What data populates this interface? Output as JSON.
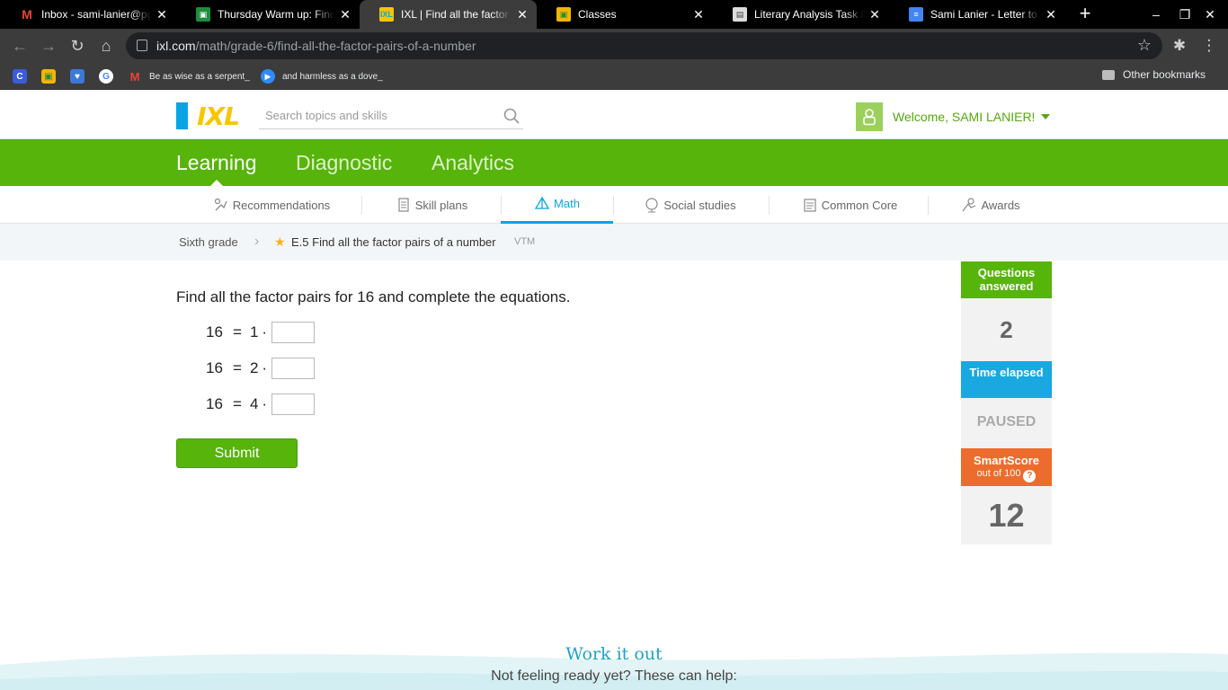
{
  "browser": {
    "tabs": [
      {
        "title": "Inbox - sami-lanier@pgcps.org",
        "icon": "gmail-icon",
        "active": false
      },
      {
        "title": "Thursday Warm up: Find the factor pairs",
        "icon": "classroom-icon",
        "active": false
      },
      {
        "title": "IXL | Find all the factor pairs",
        "icon": "ixl-icon",
        "active": true
      },
      {
        "title": "Classes",
        "icon": "classroom-icon",
        "active": false
      },
      {
        "title": "Literary Analysis Task Pi",
        "icon": "classroom-assignment-icon",
        "active": false
      },
      {
        "title": "Sami Lanier - Letter to Co",
        "icon": "docs-icon",
        "active": false
      }
    ],
    "url_host": "ixl.com",
    "url_path": "/math/grade-6/find-all-the-factor-pairs-of-a-number",
    "bookmarks": [
      {
        "label": "",
        "icon": "canvas-icon"
      },
      {
        "label": "",
        "icon": "classroom-icon"
      },
      {
        "label": "",
        "icon": "heart-icon"
      },
      {
        "label": "",
        "icon": "google-icon"
      },
      {
        "label": "Be as wise as a serpent_",
        "icon": "gmail-icon"
      },
      {
        "label": "and harmless as a dove_",
        "icon": "zoom-icon"
      }
    ],
    "other_bookmarks": "Other bookmarks"
  },
  "header": {
    "logo": "IXL",
    "search_placeholder": "Search topics and skills",
    "welcome": "Welcome, SAMI LANIER!"
  },
  "main_nav": [
    {
      "label": "Learning",
      "active": true
    },
    {
      "label": "Diagnostic",
      "active": false
    },
    {
      "label": "Analytics",
      "active": false
    }
  ],
  "sub_nav": [
    {
      "label": "Recommendations",
      "icon": "recommendations-icon"
    },
    {
      "label": "Skill plans",
      "icon": "skill-plans-icon"
    },
    {
      "label": "Math",
      "icon": "math-pyramid-icon",
      "active": true
    },
    {
      "label": "Social studies",
      "icon": "globe-icon"
    },
    {
      "label": "Common Core",
      "icon": "common-core-icon"
    },
    {
      "label": "Awards",
      "icon": "awards-icon"
    }
  ],
  "breadcrumb": {
    "grade": "Sixth grade",
    "skill": "E.5 Find all the factor pairs of a number",
    "code": "VTM"
  },
  "question": {
    "prompt": "Find all the factor pairs for 16 and complete the equations.",
    "equations": [
      {
        "lhs": "16",
        "factor": "1",
        "answer": ""
      },
      {
        "lhs": "16",
        "factor": "2",
        "answer": ""
      },
      {
        "lhs": "16",
        "factor": "4",
        "answer": ""
      }
    ],
    "submit_label": "Submit"
  },
  "stats": {
    "questions_answered_label": "Questions answered",
    "questions_answered": "2",
    "time_elapsed_label": "Time elapsed",
    "time_elapsed": "PAUSED",
    "smartscore_label": "SmartScore",
    "smartscore_sub": "out of 100",
    "smartscore": "12"
  },
  "footer": {
    "title": "Work it out",
    "subtitle": "Not feeling ready yet? These can help:"
  },
  "colors": {
    "ixl_green": "#56b40b",
    "ixl_blue": "#19a9e0",
    "ixl_orange": "#ec6c2d",
    "ixl_yellow": "#f7c600"
  }
}
